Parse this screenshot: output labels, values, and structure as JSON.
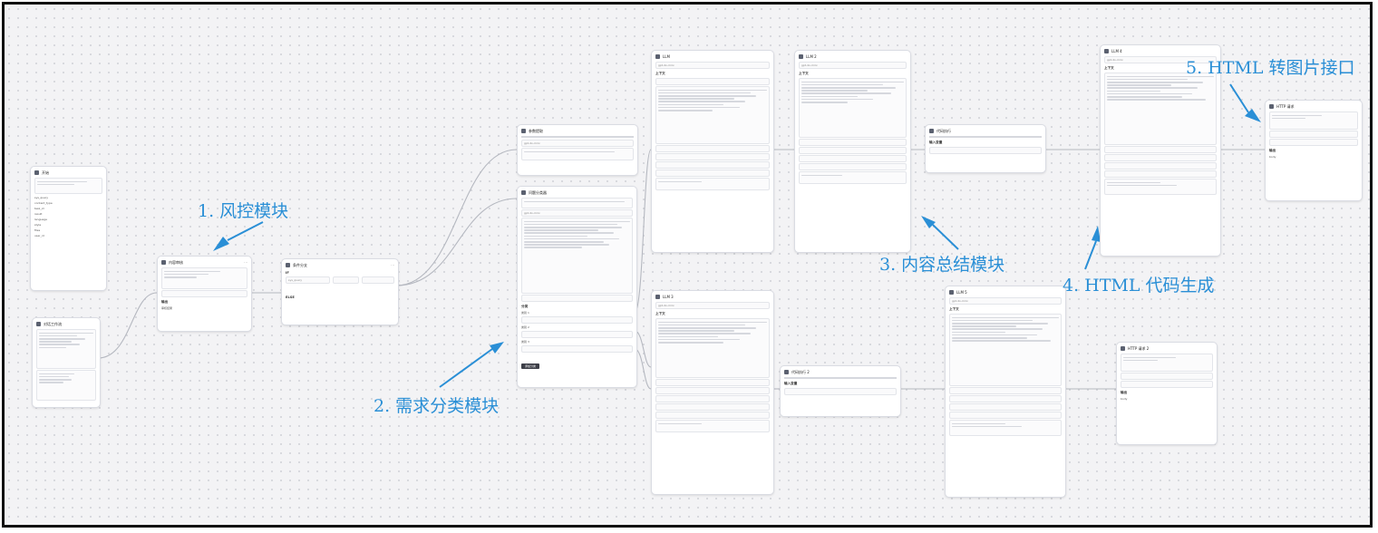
{
  "annotations": {
    "risk": "1. 风控模块",
    "classify": "2. 需求分类模块",
    "summary": "3. 内容总结模块",
    "html_gen": "4. HTML 代码生成",
    "html_img": "5. HTML 转图片接口"
  },
  "colors": {
    "annotation": "#2a8fd6",
    "edge": "#b5b8c0",
    "canvas": "#f3f3f5"
  },
  "nodes": {
    "start": {
      "title": "开始",
      "params": [
        "sys_query",
        "content_type",
        "task_id",
        "result",
        "language",
        "style",
        "files",
        "user_id"
      ]
    },
    "workflow": {
      "title": "对话工作流"
    },
    "risk": {
      "title": "内容审核",
      "sec": "输出",
      "field": "审核结果"
    },
    "condition": {
      "title": "条件分支",
      "if": "IF",
      "else": "ELSE",
      "field": "sys_query"
    },
    "extract": {
      "title": "参数提取",
      "sec": "输入",
      "field": "gpt-4o-mini"
    },
    "classifier": {
      "title": "问题分类器",
      "model": "gpt-4o-mini",
      "sec": "分类",
      "classes": [
        "类别 1",
        "类别 2",
        "类别 3"
      ],
      "button": "添加分类"
    },
    "llm1": {
      "title": "LLM",
      "model": "gpt-4o-mini",
      "sec": "上下文"
    },
    "llm2": {
      "title": "LLM 2",
      "model": "gpt-4o-mini",
      "sec": "上下文"
    },
    "llm3": {
      "title": "LLM 3",
      "model": "gpt-4o-mini",
      "sec": "上下文"
    },
    "code1": {
      "title": "代码执行",
      "sec": "输入变量"
    },
    "code2": {
      "title": "代码执行 2",
      "sec": "输入变量"
    },
    "llm_html1": {
      "title": "LLM 4",
      "model": "gpt-4o-mini",
      "sec": "上下文"
    },
    "llm_html2": {
      "title": "LLM 5",
      "model": "gpt-4o-mini",
      "sec": "上下文"
    },
    "http1": {
      "title": "HTTP 请求",
      "sec": "输出",
      "field": "body"
    },
    "http2": {
      "title": "HTTP 请求 2",
      "sec": "输出",
      "field": "body"
    }
  }
}
